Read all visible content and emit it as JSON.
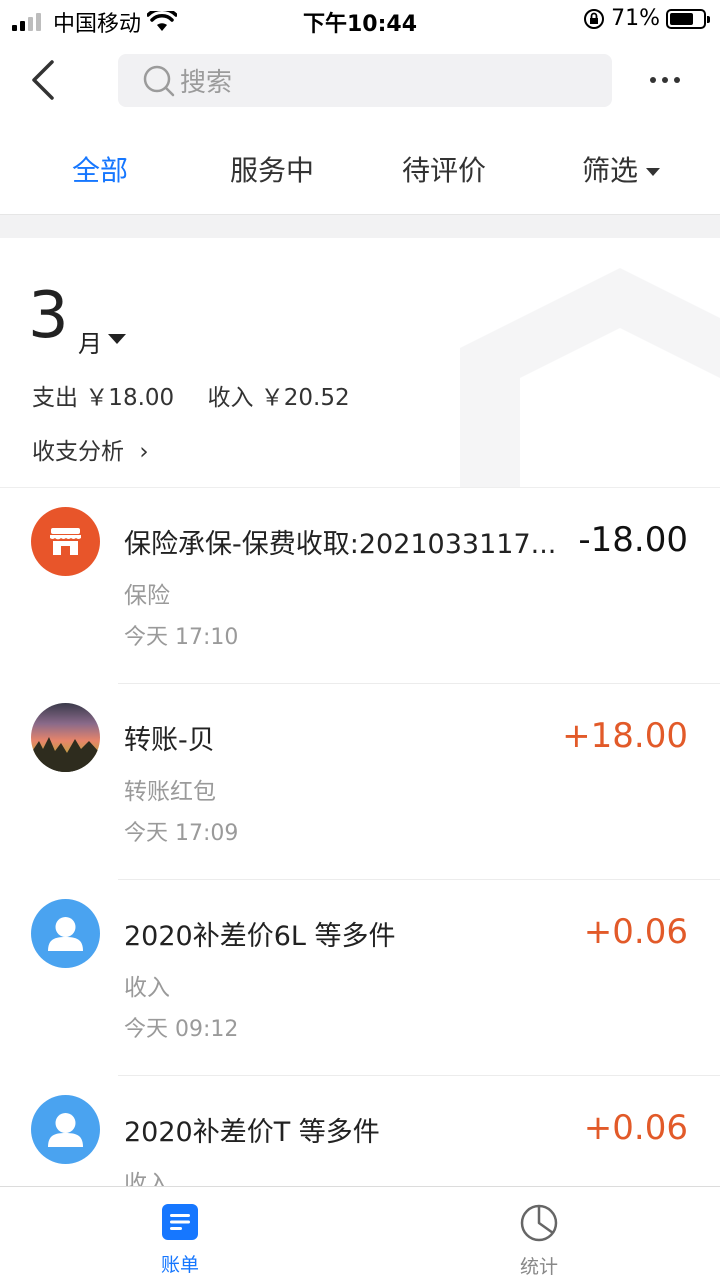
{
  "status_bar": {
    "carrier": "中国移动",
    "time": "下午10:44",
    "battery": "71%"
  },
  "search": {
    "placeholder": "搜索"
  },
  "tabs": [
    {
      "label": "全部",
      "active": true
    },
    {
      "label": "服务中",
      "active": false
    },
    {
      "label": "待评价",
      "active": false
    },
    {
      "label": "筛选",
      "active": false
    }
  ],
  "summary": {
    "month": "3",
    "month_unit": "月",
    "expense": "支出 ￥18.00",
    "income": "收入 ￥20.52",
    "analysis": "收支分析",
    "analysis_arrow": "›"
  },
  "transactions": [
    {
      "title": "保险承保-保费收取:2021033117...",
      "category": "保险",
      "time": "今天  17:10",
      "amount": "-18.00",
      "type": "expense",
      "icon": "store-icon"
    },
    {
      "title": "转账-贝",
      "category": "转账红包",
      "time": "今天  17:09",
      "amount": "+18.00",
      "type": "income",
      "icon": "user-photo"
    },
    {
      "title": "2020补差价6L 等多件",
      "category": "收入",
      "time": "今天  09:12",
      "amount": "+0.06",
      "type": "income",
      "icon": "person-icon"
    },
    {
      "title": "2020补差价T 等多件",
      "category": "收入",
      "time": "",
      "amount": "+0.06",
      "type": "income",
      "icon": "person-icon"
    }
  ],
  "bottom_nav": [
    {
      "label": "账单",
      "active": true,
      "icon": "bill-icon"
    },
    {
      "label": "统计",
      "active": false,
      "icon": "pie-chart-icon"
    }
  ],
  "colors": {
    "accent": "#1677ff",
    "income": "#e25a29",
    "store": "#e8552a",
    "person": "#4aa3f0"
  }
}
